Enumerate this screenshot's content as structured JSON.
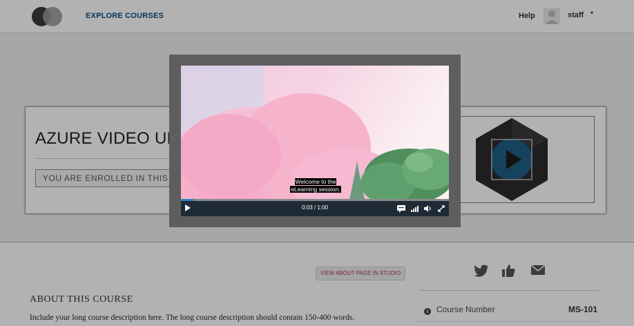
{
  "header": {
    "nav_link": "EXPLORE COURSES",
    "help": "Help",
    "username": "staff",
    "caret": "▾"
  },
  "course": {
    "title": "AZURE VIDEO UPLOAD",
    "enrolled": "YOU ARE ENROLLED IN THIS COURSE"
  },
  "video": {
    "caption_line1": "Welcome to the",
    "caption_line2": "eLearning session.",
    "time": "0:03 / 1:00",
    "progress": 0.05
  },
  "about": {
    "studio_button": "VIEW ABOUT PAGE IN STUDIO",
    "title": "ABOUT THIS COURSE",
    "text": "Include your long course description here. The long course description should contain 150-400 words."
  },
  "sidebar": {
    "course_number_label": "Course Number",
    "course_number_value": "MS-101",
    "info_glyph": "i"
  },
  "icons": {
    "logo": "edx-logo",
    "avatar": "user-avatar-icon",
    "social": [
      "twitter-icon",
      "thumbs-up-icon",
      "mail-icon"
    ],
    "controls": [
      "play-icon",
      "captions-icon",
      "quality-icon",
      "volume-icon",
      "fullscreen-icon"
    ]
  },
  "colors": {
    "nav_link": "#0a4c80",
    "accent_progress": "#2e86c1",
    "studio_button_text": "#a8336a",
    "overlay": "rgba(0,0,0,0.30)"
  }
}
